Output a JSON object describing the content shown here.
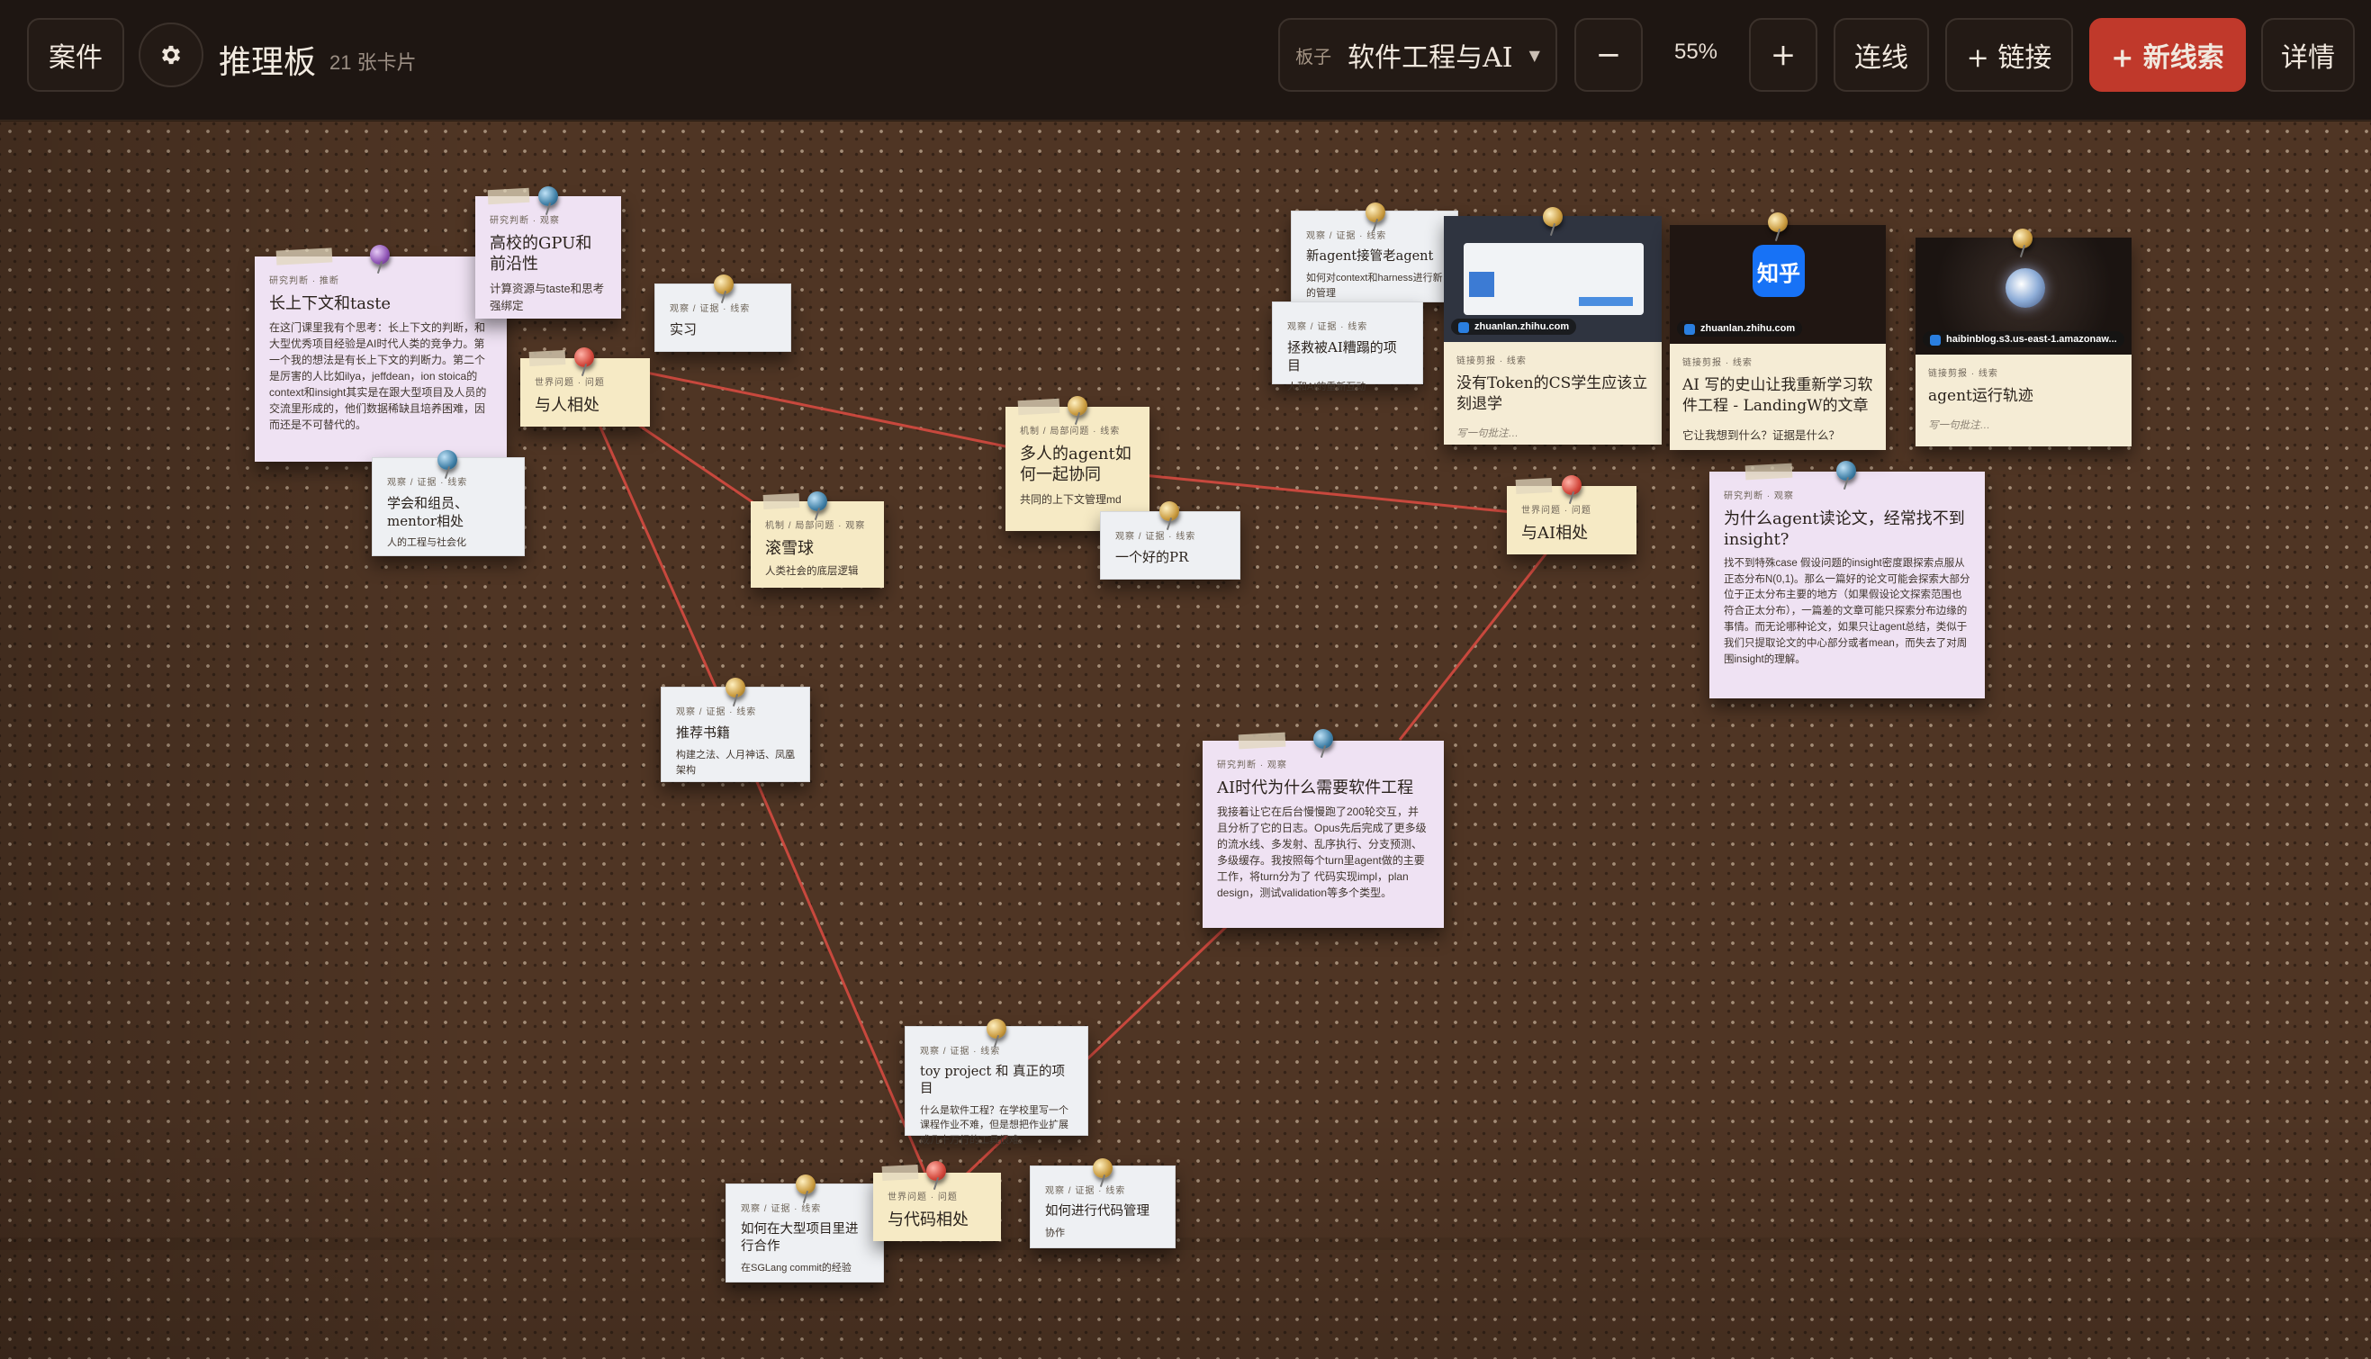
{
  "toolbar": {
    "case_button": "案件",
    "settings_icon": "gear-icon",
    "board_title": "推理板",
    "card_count": "21 张卡片",
    "board_select_label": "板子",
    "board_select_value": "软件工程与AI",
    "zoom_out": "−",
    "zoom_level": "55%",
    "zoom_in": "+",
    "connect": "连线",
    "add_link": "+ 链接",
    "new_clue": "+ 新线索",
    "details": "详情"
  },
  "colors": {
    "accent_red": "#c0392b",
    "string_red": "#c9463d",
    "board_brown": "#4f3524"
  },
  "cards": [
    {
      "id": "c1",
      "tag": "研究判断 · 推断",
      "title": "长上下文和taste",
      "body": "在这门课里我有个思考：长上下文的判断，和大型优秀项目经验是AI时代人类的竞争力。第一个我的想法是有长上下文的判断力。第二个是厉害的人比如ilya，jeffdean，ion stoica的context和insight其实是在跟大型项目及人员的交流里形成的，他们数据稀缺且培养困难，因而还是不可替代的。"
    },
    {
      "id": "c2",
      "tag": "研究判断 · 观察",
      "title": "高校的GPU和前沿性",
      "body": "计算资源与taste和思考强绑定"
    },
    {
      "id": "c3",
      "tag": "观察 / 证据 · 线索",
      "title": "实习",
      "body": ""
    },
    {
      "id": "c4",
      "tag": "世界问题 · 问题",
      "title": "与人相处",
      "body": ""
    },
    {
      "id": "c5",
      "tag": "观察 / 证据 · 线索",
      "title": "学会和组员、mentor相处",
      "body": "人的工程与社会化"
    },
    {
      "id": "c6",
      "tag": "机制 / 局部问题 · 观察",
      "title": "滚雪球",
      "body": "人类社会的底层逻辑"
    },
    {
      "id": "c7",
      "tag": "机制 / 局部问题 · 线索",
      "title": "多人的agent如何一起协同",
      "body": "共同的上下文管理md"
    },
    {
      "id": "c8",
      "tag": "观察 / 证据 · 线索",
      "title": "一个好的PR",
      "body": ""
    },
    {
      "id": "c9",
      "tag": "观察 / 证据 · 线索",
      "title": "新agent接管老agent",
      "body": "如何对context和harness进行新的管理"
    },
    {
      "id": "c10",
      "tag": "观察 / 证据 · 线索",
      "title": "拯救被AI糟蹋的项目",
      "body": "人和AI的重新互动"
    },
    {
      "id": "c11",
      "tag": "世界问题 · 问题",
      "title": "与AI相处",
      "body": ""
    },
    {
      "id": "c12",
      "tag": "研究判断 · 观察",
      "title": "为什么agent读论文，经常找不到insight?",
      "body": "找不到特殊case 假设问题的insight密度跟探索点服从正态分布N(0,1)。那么一篇好的论文可能会探索大部分位于正太分布主要的地方（如果假设论文探索范围也符合正太分布），一篇差的文章可能只探索分布边缘的事情。而无论哪种论文，如果只让agent总结，类似于我们只提取论文的中心部分或者mean，而失去了对周围insight的理解。"
    },
    {
      "id": "c13",
      "tag": "观察 / 证据 · 线索",
      "title": "推荐书籍",
      "body": "构建之法、人月神话、凤凰架构"
    },
    {
      "id": "c14",
      "tag": "研究判断 · 观察",
      "title": "AI时代为什么需要软件工程",
      "body": "我接着让它在后台慢慢跑了200轮交互，并且分析了它的日志。Opus先后完成了更多级的流水线、多发射、乱序执行、分支预测、多级缓存。我按照每个turn里agent做的主要工作，将turn分为了 代码实现impl，plan design，测试validation等多个类型。"
    },
    {
      "id": "c15",
      "tag": "观察 / 证据 · 线索",
      "title": "toy project 和 真正的项目",
      "body": "什么是软件工程？在学校里写一个课程作业不难，但是想把作业扩展成几十万行的工具很难。"
    },
    {
      "id": "c16",
      "tag": "观察 / 证据 · 线索",
      "title": "如何在大型项目里进行合作",
      "body": "在SGLang commit的经验"
    },
    {
      "id": "c17",
      "tag": "世界问题 · 问题",
      "title": "与代码相处",
      "body": ""
    },
    {
      "id": "c18",
      "tag": "观察 / 证据 · 线索",
      "title": "如何进行代码管理",
      "body": "协作"
    }
  ],
  "links": [
    {
      "id": "l1",
      "domain": "zhuanlan.zhihu.com",
      "tag": "链接剪报 · 线索",
      "title": "没有Token的CS学生应该立刻退学",
      "note": "写一句批注…",
      "question": ""
    },
    {
      "id": "l2",
      "domain": "zhuanlan.zhihu.com",
      "logo": "知乎",
      "tag": "链接剪报 · 线索",
      "title": "AI 写的史山让我重新学习软件工程 - LandingW的文章",
      "note": "",
      "question": "它让我想到什么？证据是什么？"
    },
    {
      "id": "l3",
      "domain": "haibinblog.s3.us-east-1.amazonaw...",
      "tag": "链接剪报 · 线索",
      "title": "agent运行轨迹",
      "note": "写一句批注…",
      "question": ""
    }
  ]
}
